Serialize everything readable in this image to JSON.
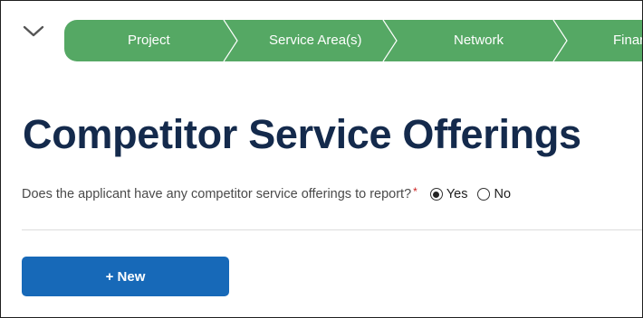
{
  "stepper": {
    "steps": [
      {
        "label": "Project"
      },
      {
        "label": "Service Area(s)"
      },
      {
        "label": "Network"
      },
      {
        "label": "Finar"
      }
    ],
    "color": "#55a864"
  },
  "page": {
    "title": "Competitor Service Offerings"
  },
  "question": {
    "text": "Does the applicant have any competitor service offerings to report?",
    "required_marker": "*",
    "options": [
      {
        "label": "Yes",
        "selected": true
      },
      {
        "label": "No",
        "selected": false
      }
    ]
  },
  "actions": {
    "new_label": "+ New"
  },
  "colors": {
    "title": "#142a4c",
    "primary_button": "#1769b8",
    "required": "#cc1f1f"
  }
}
